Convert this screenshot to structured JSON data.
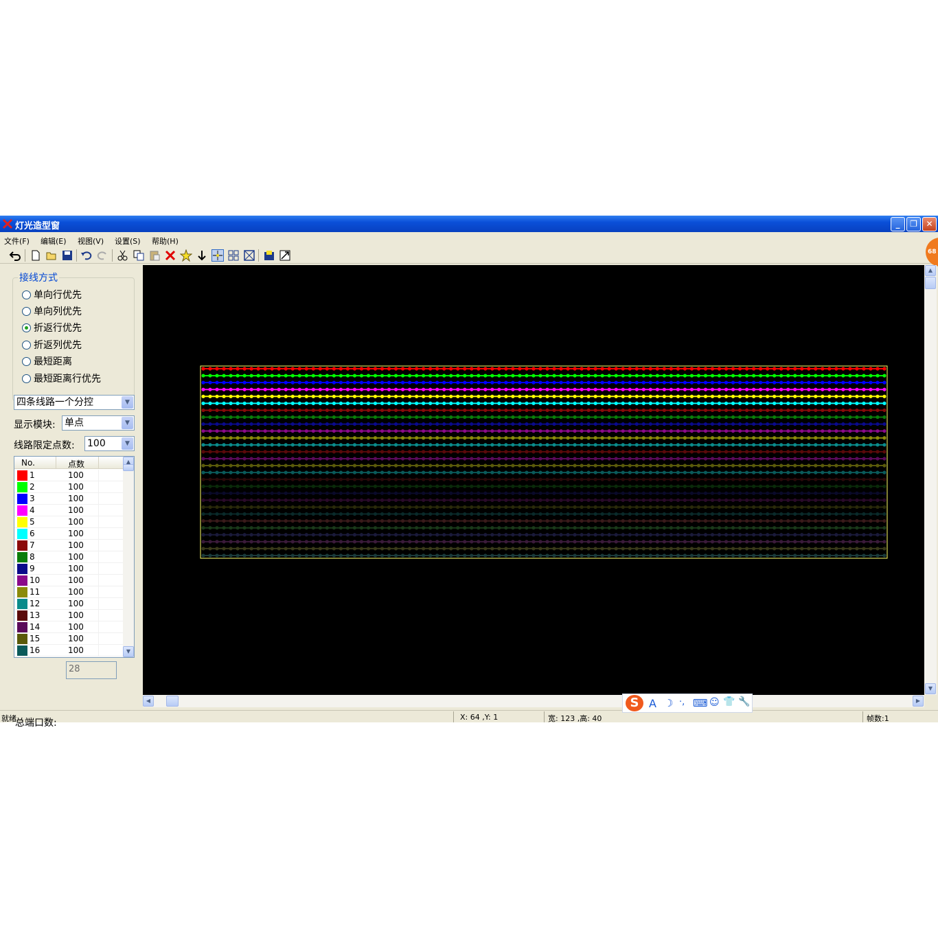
{
  "window": {
    "title": "灯光造型窗",
    "minimize": "_",
    "restore": "❐",
    "close": "✕"
  },
  "menu": [
    "文件(F)",
    "编辑(E)",
    "视图(V)",
    "设置(S)",
    "帮助(H)"
  ],
  "badge": "68",
  "toolbar": {
    "icons": [
      "undo-icon",
      "new-file-icon",
      "open-folder-icon",
      "save-icon",
      "undo-arrow-icon",
      "redo-arrow-icon",
      "cut-icon",
      "copy-icon",
      "paste-icon",
      "delete-icon",
      "star-icon",
      "down-arrow-icon",
      "crosshair-icon",
      "grid-icon",
      "box-icon",
      "save-disk-icon",
      "export-icon"
    ]
  },
  "wiring": {
    "group_title": "接线方式",
    "options": [
      "单向行优先",
      "单向列优先",
      "折返行优先",
      "折返列优先",
      "最短距离",
      "最短距离行优先"
    ],
    "selected_index": 2
  },
  "control_mode": {
    "value": "四条线路一个分控"
  },
  "display_module": {
    "label": "显示模块:",
    "value": "单点"
  },
  "line_limit": {
    "label": "线路限定点数:",
    "value": "100"
  },
  "ports": {
    "headers": [
      "No.",
      "点数"
    ],
    "rows": [
      {
        "no": "1",
        "count": "100",
        "color": "#ff0000"
      },
      {
        "no": "2",
        "count": "100",
        "color": "#00ff00"
      },
      {
        "no": "3",
        "count": "100",
        "color": "#0000ff"
      },
      {
        "no": "4",
        "count": "100",
        "color": "#ff00ff"
      },
      {
        "no": "5",
        "count": "100",
        "color": "#ffff00"
      },
      {
        "no": "6",
        "count": "100",
        "color": "#00ffff"
      },
      {
        "no": "7",
        "count": "100",
        "color": "#8b0a0a"
      },
      {
        "no": "8",
        "count": "100",
        "color": "#0a7d0a"
      },
      {
        "no": "9",
        "count": "100",
        "color": "#0a0a8b"
      },
      {
        "no": "10",
        "count": "100",
        "color": "#8b0a8b"
      },
      {
        "no": "11",
        "count": "100",
        "color": "#8b8b0a"
      },
      {
        "no": "12",
        "count": "100",
        "color": "#0a8b8b"
      },
      {
        "no": "13",
        "count": "100",
        "color": "#5a0a0a"
      },
      {
        "no": "14",
        "count": "100",
        "color": "#5a0a5a"
      },
      {
        "no": "15",
        "count": "100",
        "color": "#5a5a0a"
      },
      {
        "no": "16",
        "count": "100",
        "color": "#0a5a5a"
      }
    ]
  },
  "total_ports": {
    "label": "总端口数:",
    "value": "28"
  },
  "grid": {
    "line_colors": [
      "#ff0000",
      "#00ff00",
      "#0000ff",
      "#ff00ff",
      "#ffff00",
      "#00ffff",
      "#8b0a0a",
      "#0a7d0a",
      "#0a0a8b",
      "#8b0a8b",
      "#8b8b0a",
      "#0a8b8b",
      "#5a0a0a",
      "#5a0a5a",
      "#5a5a0a",
      "#0a5a5a",
      "#2a0a0a",
      "#0a2a0a",
      "#0a0a2a",
      "#2a0a2a",
      "#2a2a0a",
      "#0a2a2a",
      "#3a1a1a",
      "#1a3a1a",
      "#1a1a3a",
      "#3a1a3a",
      "#3a3a1a",
      "#1a3a3a"
    ],
    "frame_color": "#ffff66"
  },
  "status": {
    "ready": "就绪",
    "coords": "X: 64 ,Y: 1",
    "size": "宽: 123 ,高: 40",
    "frames": "帧数:1"
  },
  "ime": {
    "logo": "S",
    "items": [
      "A",
      "☽",
      "·,",
      "⌨",
      "☺",
      "👕",
      "🔧"
    ]
  }
}
